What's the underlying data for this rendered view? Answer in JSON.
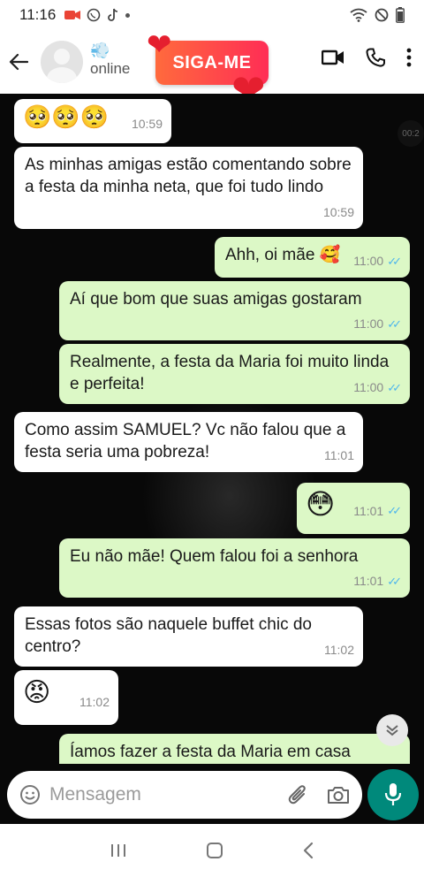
{
  "status_bar": {
    "time": "11:16"
  },
  "header": {
    "contact_emoji": "💨",
    "contact_status": "online",
    "promo_label": "SIGA-ME"
  },
  "chat": {
    "side_badge": "00:2",
    "messages": [
      {
        "dir": "in",
        "text": "🥺🥺🥺",
        "time": "10:59"
      },
      {
        "dir": "in",
        "text": "As minhas amigas estão comentando sobre a festa da minha neta, que foi tudo lindo",
        "time": "10:59"
      },
      {
        "dir": "out",
        "text": "Ahh, oi mãe 🥰",
        "time": "11:00"
      },
      {
        "dir": "out",
        "text": "Aí que bom que suas amigas gostaram",
        "time": "11:00"
      },
      {
        "dir": "out",
        "text": "Realmente,  a festa da Maria foi muito linda e perfeita!",
        "time": "11:00"
      },
      {
        "dir": "in",
        "text": "Como assim SAMUEL? Vc não falou que a festa seria uma pobreza!",
        "time": "11:01"
      },
      {
        "dir": "out",
        "text": "😳",
        "time": "11:01"
      },
      {
        "dir": "out",
        "text": "Eu não mãe! Quem falou foi a senhora",
        "time": "11:01"
      },
      {
        "dir": "in",
        "text": "Essas fotos são naquele buffet chic do centro?",
        "time": "11:02"
      },
      {
        "dir": "in",
        "text": "😡",
        "time": "11:02"
      },
      {
        "dir": "out",
        "text": "Íamos fazer a festa da Maria em casa",
        "time": ""
      }
    ]
  },
  "input": {
    "placeholder": "Mensagem"
  },
  "colors": {
    "outgoing": "#dcf8c6",
    "incoming": "#ffffff",
    "accent": "#00897b",
    "tick": "#4fb6ec"
  }
}
